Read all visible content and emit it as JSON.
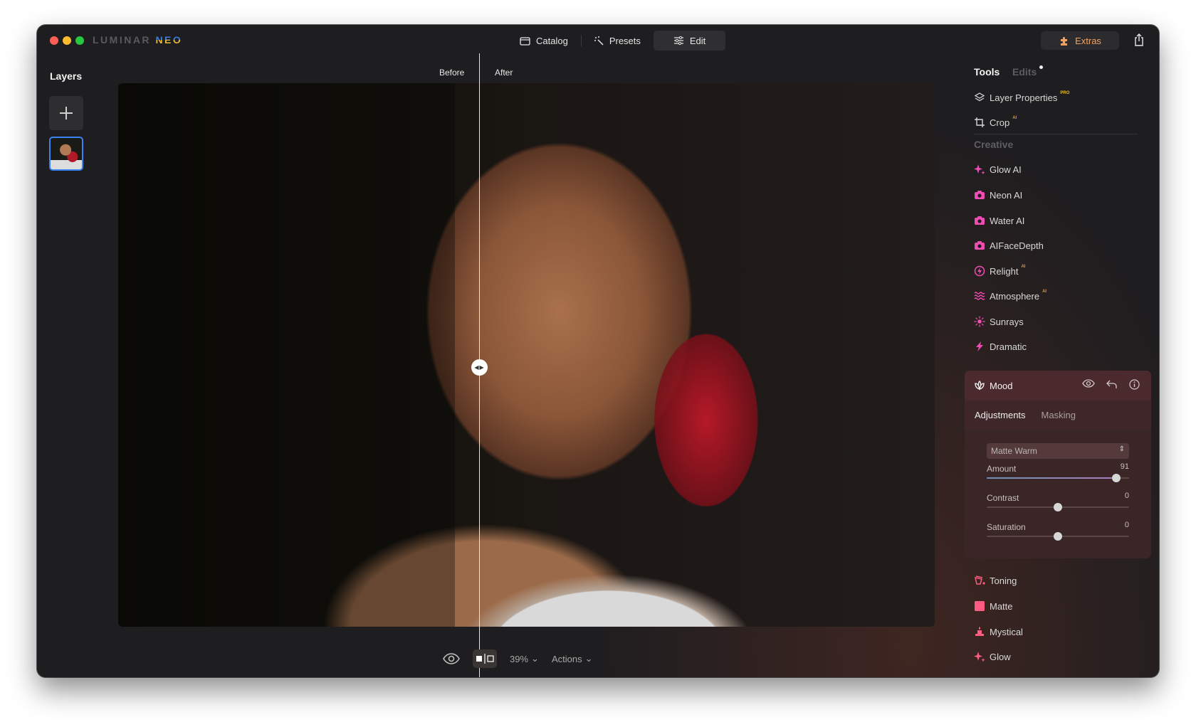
{
  "app": {
    "brand_part1": "LUMINAR",
    "brand_part2": "NEO"
  },
  "nav": {
    "items": [
      {
        "label": "Catalog",
        "icon": "folder-icon",
        "active": false
      },
      {
        "label": "Presets",
        "icon": "magic-wand-icon",
        "active": false
      },
      {
        "label": "Edit",
        "icon": "sliders-icon",
        "active": true
      }
    ],
    "extras_label": "Extras",
    "extras_color": "#f0a263"
  },
  "layers": {
    "title": "Layers"
  },
  "canvas": {
    "before_label": "Before",
    "after_label": "After",
    "zoom": "39%",
    "actions_label": "Actions"
  },
  "right_panel": {
    "tabs": {
      "tools": "Tools",
      "edits": "Edits"
    },
    "top_tools": [
      {
        "label": "Layer Properties",
        "badge": "PRO",
        "icon": "layers-icon"
      },
      {
        "label": "Crop",
        "badge": "AI",
        "icon": "crop-icon"
      }
    ],
    "section_title": "Creative",
    "creative_tools": [
      {
        "label": "Glow AI",
        "badge": "",
        "icon": "sparkle-icon"
      },
      {
        "label": "Neon AI",
        "badge": "",
        "icon": "camera-icon"
      },
      {
        "label": "Water AI",
        "badge": "",
        "icon": "camera-icon"
      },
      {
        "label": "AIFaceDepth",
        "badge": "",
        "icon": "camera-icon"
      },
      {
        "label": "Relight",
        "badge": "AI",
        "icon": "lightning-circle-icon"
      },
      {
        "label": "Atmosphere",
        "badge": "AI",
        "icon": "waves-icon"
      },
      {
        "label": "Sunrays",
        "badge": "",
        "icon": "sun-icon"
      },
      {
        "label": "Dramatic",
        "badge": "",
        "icon": "bolt-icon"
      }
    ],
    "mood": {
      "title": "Mood",
      "tab_adjustments": "Adjustments",
      "tab_masking": "Masking",
      "preset": "Matte Warm",
      "sliders": [
        {
          "label": "Amount",
          "value": "91",
          "fraction": 0.91,
          "bipolar": false
        },
        {
          "label": "Contrast",
          "value": "0",
          "fraction": 0.5,
          "bipolar": true
        },
        {
          "label": "Saturation",
          "value": "0",
          "fraction": 0.5,
          "bipolar": true
        }
      ]
    },
    "bottom_tools": [
      {
        "label": "Toning",
        "icon": "paint-bucket-icon"
      },
      {
        "label": "Matte",
        "icon": "square-icon"
      },
      {
        "label": "Mystical",
        "icon": "candle-icon"
      },
      {
        "label": "Glow",
        "icon": "sparkle-icon"
      }
    ],
    "creative_icon_color": "#f04db4",
    "bottom_icon_color": "#ff5c82"
  }
}
